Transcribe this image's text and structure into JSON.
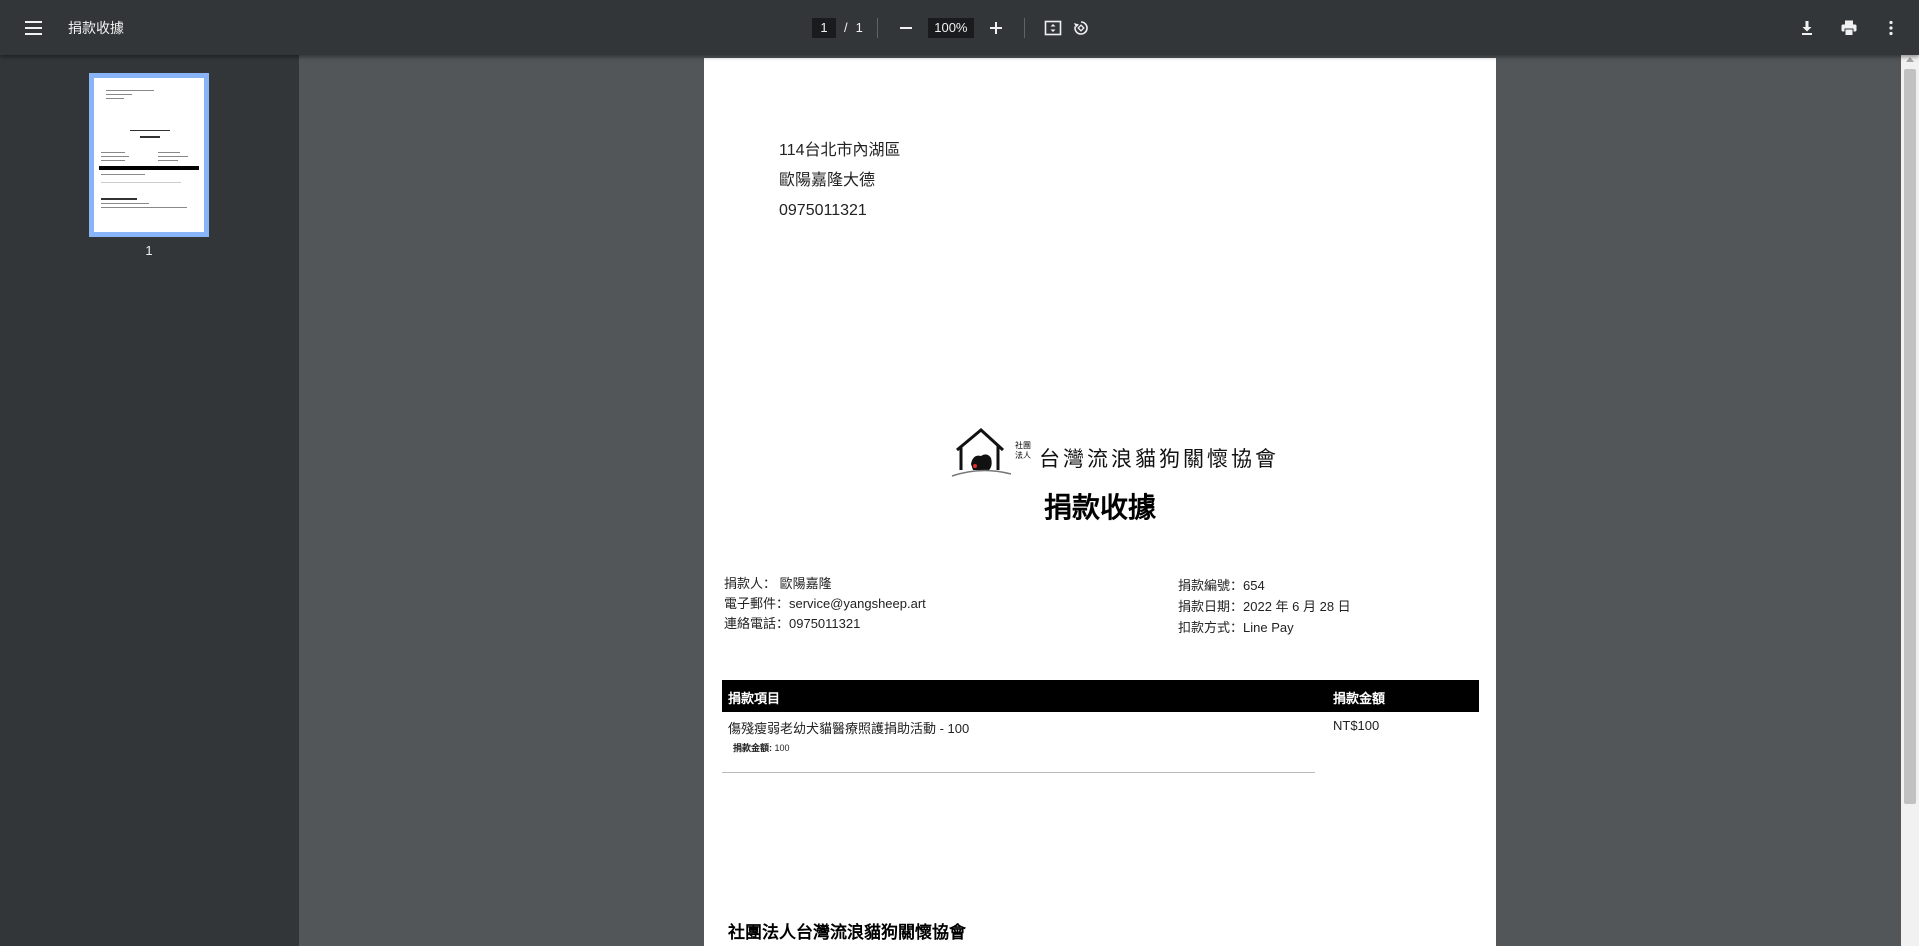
{
  "toolbar": {
    "title": "捐款收據",
    "page_current": "1",
    "page_separator": "/",
    "page_total": "1",
    "zoom": "100%"
  },
  "sidebar": {
    "thumbnail_label": "1"
  },
  "document": {
    "address_lines": [
      "114台北市內湖區",
      "歐陽嘉隆大德",
      "0975011321"
    ],
    "logo_text": "台灣流浪貓狗關懷協會",
    "logo_small_text": "社團法人",
    "title": "捐款收據",
    "donor": {
      "name_line": "捐款人： 歐陽嘉隆",
      "email_line": "電子郵件：service@yangsheep.art",
      "phone_line": "連絡電話：0975011321"
    },
    "meta": {
      "number_line": "捐款編號：654",
      "date_line": "捐款日期：2022 年 6 月 28 日",
      "method_line": "扣款方式：Line Pay"
    },
    "table": {
      "col_item": "捐款項目",
      "col_amount": "捐款金額",
      "item_name": "傷殘瘦弱老幼犬貓醫療照護捐助活動 - 100",
      "item_sub_label": "捐款金額:",
      "item_sub_value": "100",
      "item_amount": "NT$100"
    },
    "org_name": "社團法人台灣流浪貓狗關懷協會"
  }
}
